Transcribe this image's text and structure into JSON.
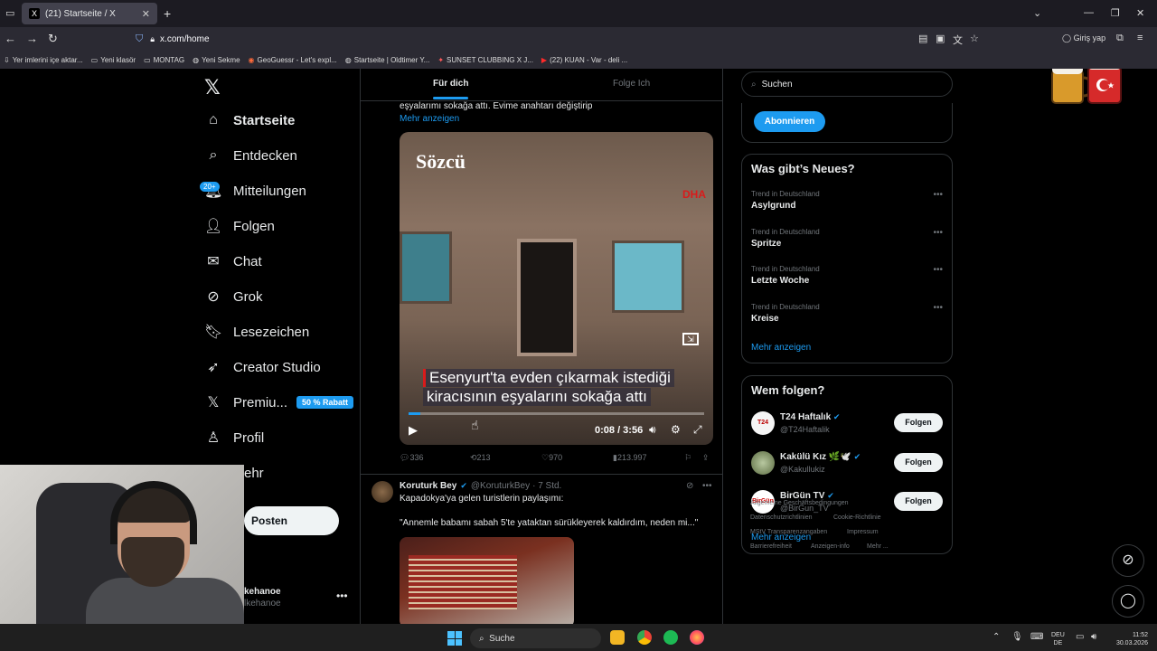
{
  "browser": {
    "tab_title": "(21) Startseite / X",
    "tab_favicon": "X",
    "url": "x.com/home",
    "login_label": "Giriş yap",
    "bookmarks": [
      {
        "icon": "import-icon",
        "label": "Yer imlerini içe aktar..."
      },
      {
        "icon": "folder-icon",
        "label": "Yeni klasör"
      },
      {
        "icon": "folder-icon",
        "label": "MONTAG"
      },
      {
        "icon": "globe-icon",
        "label": "Yeni Sekme"
      },
      {
        "icon": "pin-icon",
        "label": "GeoGuessr - Let's expl..."
      },
      {
        "icon": "globe-icon",
        "label": "Startseite | Oldtimer Y..."
      },
      {
        "icon": "flame-icon",
        "label": "SUNSET CLUBBING X J..."
      },
      {
        "icon": "youtube-icon",
        "label": "(22) KUAN - Var - deli ..."
      }
    ]
  },
  "sidebar": {
    "items": [
      {
        "icon": "home-icon",
        "label": "Startseite",
        "active": true
      },
      {
        "icon": "search-icon",
        "label": "Entdecken"
      },
      {
        "icon": "bell-icon",
        "label": "Mitteilungen",
        "badge": "20+"
      },
      {
        "icon": "add-user-icon",
        "label": "Folgen"
      },
      {
        "icon": "mail-icon",
        "label": "Chat"
      },
      {
        "icon": "grok-icon",
        "label": "Grok"
      },
      {
        "icon": "bookmark-icon",
        "label": "Lesezeichen"
      },
      {
        "icon": "rocket-icon",
        "label": "Creator Studio"
      },
      {
        "icon": "x-icon",
        "label": "Premiu...",
        "badge": "50 % Rabatt"
      },
      {
        "icon": "person-icon",
        "label": "Profil"
      },
      {
        "icon": "more-icon",
        "label": "ehr"
      }
    ],
    "post_button": "Posten",
    "account": {
      "name": "kehanoe",
      "handle": "lkehanoe"
    }
  },
  "feed": {
    "tabs": [
      "Für dich",
      "Folge Ich"
    ],
    "tweet1": {
      "text": "eşyalarımı sokağa attı. Evime anahtarı değiştirip",
      "more": "Mehr anzeigen",
      "video": {
        "logo": "Sözcü",
        "agency": "DHA",
        "caption_line1": "Esenyurt'ta evden çıkarmak istediği",
        "caption_line2": "kiracısının eşyalarını sokağa attı",
        "time": "0:08 / 3:56",
        "progress": 0.04
      },
      "stats": {
        "replies": "336",
        "reposts": "213",
        "likes": "970",
        "views": "213.997"
      }
    },
    "tweet2": {
      "name": "Koruturk Bey",
      "handle": "@KoruturkBey",
      "time": "· 7 Std.",
      "text1": "Kapadokya'ya gelen turistlerin paylaşımı:",
      "text2": "\"Annemle babamı sabah 5'te yataktan sürükleyerek kaldırdım, neden mi...\""
    }
  },
  "right": {
    "search_placeholder": "Suchen",
    "subscribe": "Abonnieren",
    "trends_title": "Was gibt’s Neues?",
    "trends": [
      {
        "label": "Trend in Deutschland",
        "topic": "Asylgrund"
      },
      {
        "label": "Trend in Deutschland",
        "topic": "Spritze"
      },
      {
        "label": "Trend in Deutschland",
        "topic": "Letzte Woche"
      },
      {
        "label": "Trend in Deutschland",
        "topic": "Kreise"
      }
    ],
    "trends_more": "Mehr anzeigen",
    "who_title": "Wem folgen?",
    "who": [
      {
        "name": "T24 Haftalık",
        "handle": "@T24Haftalik",
        "avatar": "T24",
        "button": "Folgen"
      },
      {
        "name": "Kakülü Kız 🌿🕊️",
        "handle": "@Kakullukiz",
        "avatar": "",
        "button": "Folgen"
      },
      {
        "name": "BirGün TV",
        "handle": "@BirGun_TV",
        "avatar": "BirGün",
        "button": "Folgen"
      }
    ],
    "who_more": "Mehr anzeigen",
    "footer": [
      "Allgemeine Geschäftsbedingungen",
      "Datenschutzrichtlinien",
      "Cookie-Richtlinie",
      "MStV Transparenzangaben",
      "Impressum",
      "Barrierefreiheit",
      "Anzeigen-info",
      "Mehr ..."
    ]
  },
  "taskbar": {
    "search": "Suche",
    "lang1": "DEU",
    "lang2": "DE",
    "time": "11:52",
    "date": "30.03.2026"
  }
}
